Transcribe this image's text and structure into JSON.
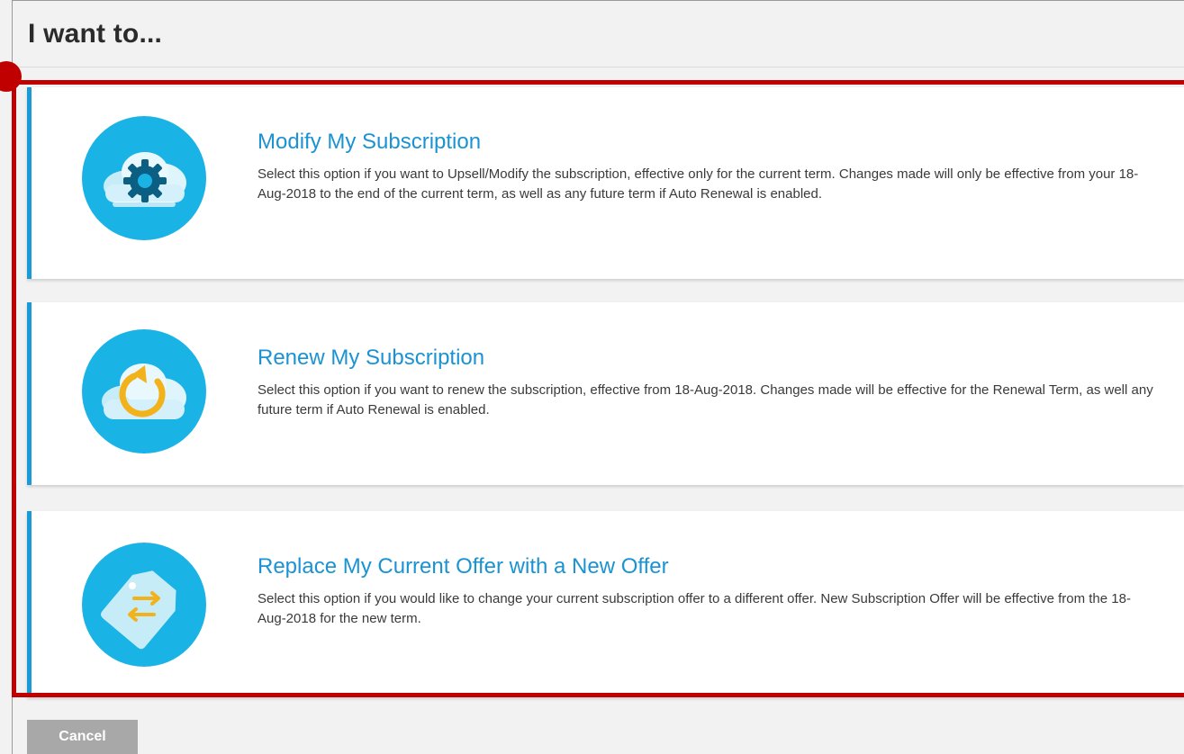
{
  "header": {
    "title": "I want to..."
  },
  "options": [
    {
      "title": "Modify My Subscription",
      "description": "Select this option if you want to Upsell/Modify the subscription, effective only for the current term. Changes made will only be effective from your 18-Aug-2018 to the end of the current term, as well as any future term if Auto Renewal is enabled.",
      "icon": "cloud-gear-icon"
    },
    {
      "title": "Renew My Subscription",
      "description": "Select this option if you want to renew the subscription, effective from 18-Aug-2018. Changes made will be effective for the Renewal Term, as well any future term if Auto Renewal is enabled.",
      "icon": "cloud-renew-icon"
    },
    {
      "title": "Replace My Current Offer with a New Offer",
      "description": "Select this option if you would like to change your current subscription offer to a different offer. New Subscription Offer will be effective from the 18-Aug-2018 for the new term.",
      "icon": "tag-swap-icon"
    }
  ],
  "footer": {
    "cancel_label": "Cancel"
  },
  "colors": {
    "accent": "#1b93d2",
    "icon_bg": "#1ab3e6",
    "highlight": "#c00000",
    "button_bg": "#a8a8a8"
  }
}
